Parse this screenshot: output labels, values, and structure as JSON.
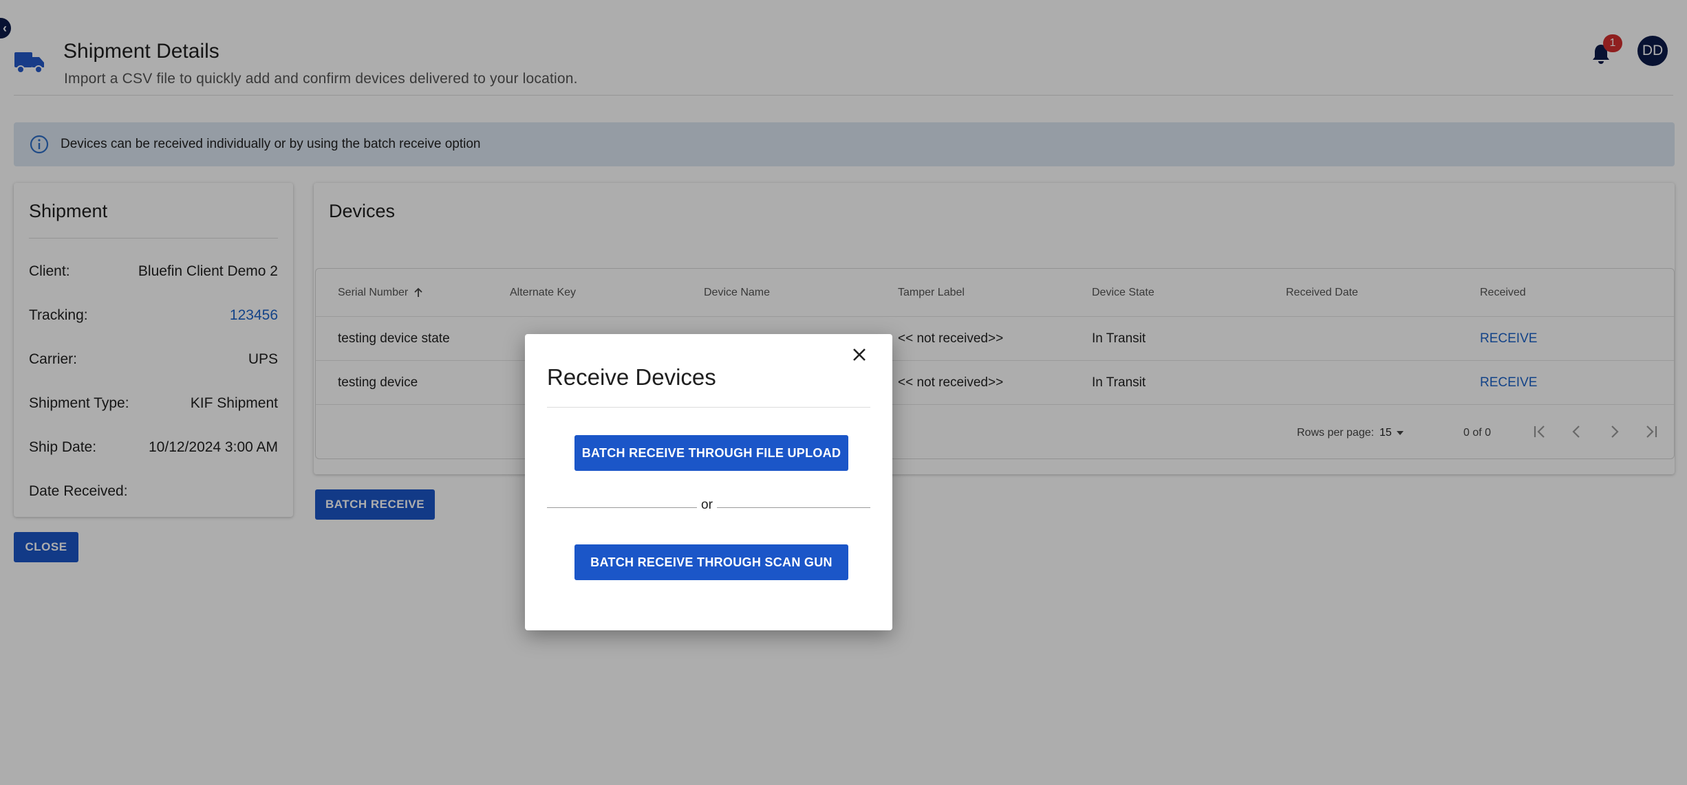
{
  "header": {
    "title": "Shipment Details",
    "subtitle": "Import a CSV file to quickly add and confirm devices delivered to your location.",
    "notification_count": "1",
    "avatar_initials": "DD"
  },
  "info_banner": {
    "text": "Devices can be received individually or by using the batch receive option"
  },
  "shipment": {
    "title": "Shipment",
    "rows": [
      {
        "label": "Client:",
        "value": "Bluefin Client Demo 2"
      },
      {
        "label": "Tracking:",
        "value": "123456"
      },
      {
        "label": "Carrier:",
        "value": "UPS"
      },
      {
        "label": "Shipment Type:",
        "value": "KIF Shipment"
      },
      {
        "label": "Ship Date:",
        "value": "10/12/2024 3:00 AM"
      },
      {
        "label": "Date Received:",
        "value": ""
      }
    ],
    "close_label": "CLOSE"
  },
  "devices": {
    "title": "Devices",
    "columns": [
      "Serial Number",
      "Alternate Key",
      "Device Name",
      "Tamper Label",
      "Device State",
      "Received Date",
      "Received"
    ],
    "rows": [
      {
        "serial": "testing device state",
        "alt_key": "",
        "device_name": "",
        "tamper_label": "<< not received>>",
        "state": "In Transit",
        "received_date": "",
        "action": "RECEIVE"
      },
      {
        "serial": "testing device",
        "alt_key": "",
        "device_name": "",
        "tamper_label": "<< not received>>",
        "state": "In Transit",
        "received_date": "",
        "action": "RECEIVE"
      }
    ],
    "pagination": {
      "rows_per_page_label": "Rows per page:",
      "rows_per_page_value": "15",
      "range": "0 of 0"
    },
    "batch_receive_label": "BATCH RECEIVE"
  },
  "modal": {
    "title": "Receive Devices",
    "file_upload_label": "BATCH RECEIVE THROUGH FILE UPLOAD",
    "or_label": "or",
    "scan_gun_label": "BATCH RECEIVE THROUGH SCAN GUN"
  },
  "colors": {
    "primary": "#1b56c8",
    "link": "#1d63c9",
    "navy": "#0d1b4b",
    "badge": "#d32f2f",
    "banner": "#dce6f2"
  }
}
